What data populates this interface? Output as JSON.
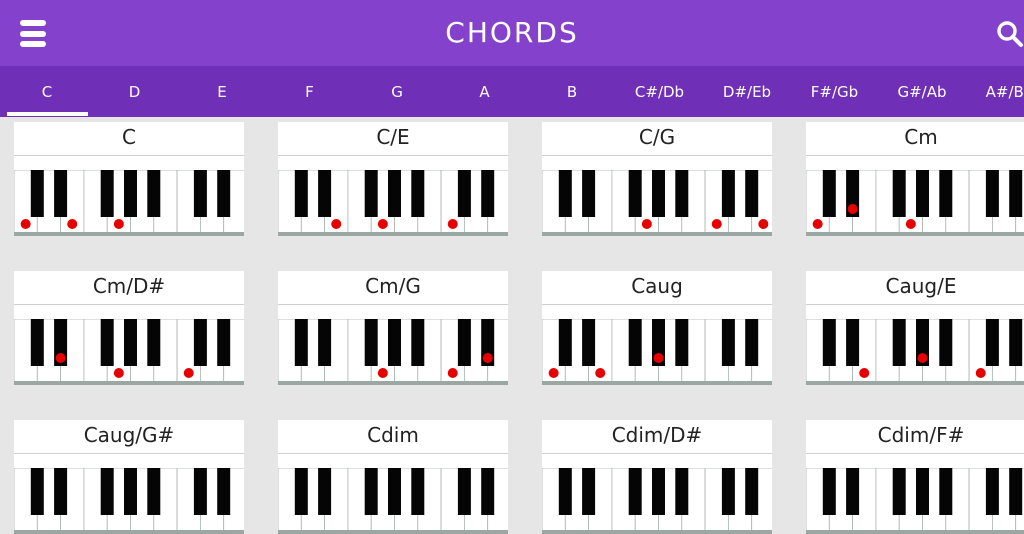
{
  "app": {
    "title": "CHORDS"
  },
  "tabs": [
    "C",
    "D",
    "E",
    "F",
    "G",
    "A",
    "B",
    "C#/Db",
    "D#/Eb",
    "F#/Gb",
    "G#/Ab",
    "A#/Bb"
  ],
  "selected_tab": "C",
  "colors": {
    "appbar": "#8341cc",
    "tabbar": "#6f2fb6",
    "note_dot": "#e60000"
  },
  "icons": {
    "menu": "hamburger-menu-icon",
    "search": "search-icon"
  },
  "chords": [
    {
      "name": "C",
      "notes": [
        "C",
        "E",
        "G"
      ]
    },
    {
      "name": "C/E",
      "notes": [
        "E",
        "G",
        "C"
      ]
    },
    {
      "name": "C/G",
      "notes": [
        "G",
        "C",
        "E"
      ]
    },
    {
      "name": "Cm",
      "notes": [
        "C",
        "D#",
        "G"
      ]
    },
    {
      "name": "Cm/D#",
      "notes": [
        "D#",
        "G",
        "C"
      ]
    },
    {
      "name": "Cm/G",
      "notes": [
        "G",
        "C",
        "D#"
      ]
    },
    {
      "name": "Caug",
      "notes": [
        "C",
        "E",
        "G#"
      ]
    },
    {
      "name": "Caug/E",
      "notes": [
        "E",
        "G#",
        "C"
      ]
    },
    {
      "name": "Caug/G#",
      "notes": []
    },
    {
      "name": "Cdim",
      "notes": []
    },
    {
      "name": "Cdim/D#",
      "notes": []
    },
    {
      "name": "Cdim/F#",
      "notes": []
    }
  ]
}
